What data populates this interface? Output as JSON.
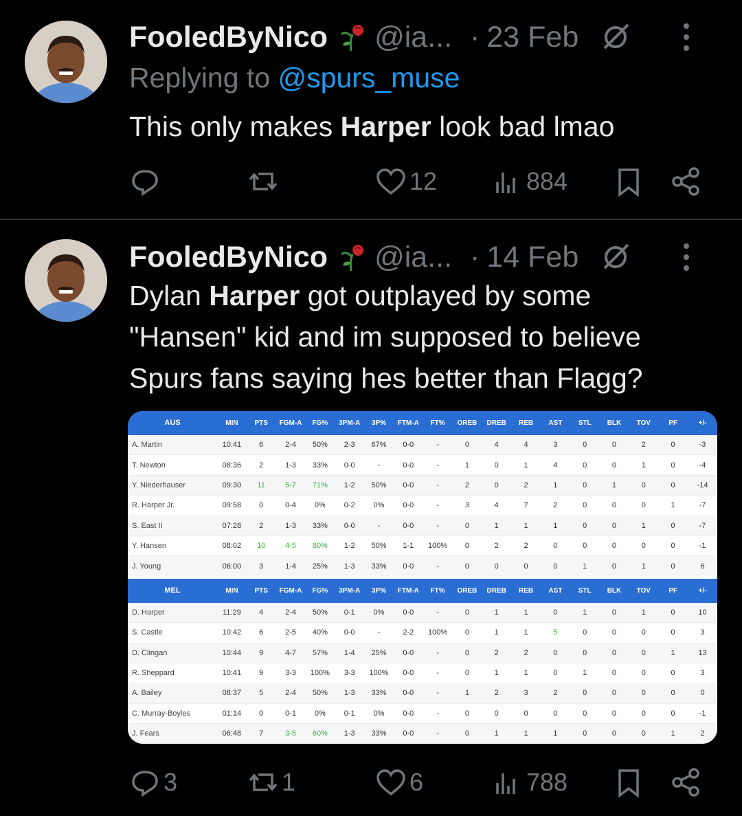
{
  "tweets": [
    {
      "display_name": "FooledByNico",
      "handle": "@ia...",
      "date": "23 Feb",
      "reply_label": "Replying to",
      "reply_to": "@spurs_muse",
      "text_before": "This only makes ",
      "text_bold": "Harper",
      "text_after": " look bad lmao",
      "likes": "12",
      "views": "884",
      "replies": "",
      "retweets": ""
    },
    {
      "display_name": "FooledByNico",
      "handle": "@ia...",
      "date": "14 Feb",
      "text_line1_a": "Dylan ",
      "text_line1_b": "Harper",
      "text_line1_c": " got outplayed by some",
      "text_line2": "\"Hansen\" kid and im supposed to believe",
      "text_line3": "Spurs fans saying hes better than Flagg?",
      "replies": "3",
      "retweets": "1",
      "likes": "6",
      "views": "788"
    }
  ],
  "stats_image": {
    "columns": [
      "MIN",
      "PTS",
      "FGM-A",
      "FG%",
      "3PM-A",
      "3P%",
      "FTM-A",
      "FT%",
      "OREB",
      "DREB",
      "REB",
      "AST",
      "STL",
      "BLK",
      "TOV",
      "PF",
      "+/-"
    ],
    "teams": [
      {
        "team": "AUS",
        "rows": [
          [
            "A. Martin",
            "10:41",
            "6",
            "2-4",
            "50%",
            "2-3",
            "67%",
            "0-0",
            "-",
            "0",
            "4",
            "4",
            "3",
            "0",
            "0",
            "2",
            "0",
            "-3"
          ],
          [
            "T. Newton",
            "08:36",
            "2",
            "1-3",
            "33%",
            "0-0",
            "-",
            "0-0",
            "-",
            "1",
            "0",
            "1",
            "4",
            "0",
            "0",
            "1",
            "0",
            "-4"
          ],
          [
            "Y. Niederhauser",
            "09:30",
            "11",
            "5-7",
            "71%",
            "1-2",
            "50%",
            "0-0",
            "-",
            "2",
            "0",
            "2",
            "1",
            "0",
            "1",
            "0",
            "0",
            "-14"
          ],
          [
            "R. Harper Jr.",
            "09:58",
            "0",
            "0-4",
            "0%",
            "0-2",
            "0%",
            "0-0",
            "-",
            "3",
            "4",
            "7",
            "2",
            "0",
            "0",
            "0",
            "1",
            "-7"
          ],
          [
            "S. East II",
            "07:28",
            "2",
            "1-3",
            "33%",
            "0-0",
            "-",
            "0-0",
            "-",
            "0",
            "1",
            "1",
            "1",
            "0",
            "0",
            "1",
            "0",
            "-7"
          ],
          [
            "Y. Hansen",
            "08:02",
            "10",
            "4-5",
            "80%",
            "1-2",
            "50%",
            "1-1",
            "100%",
            "0",
            "2",
            "2",
            "0",
            "0",
            "0",
            "0",
            "0",
            "-1"
          ],
          [
            "J. Young",
            "06:00",
            "3",
            "1-4",
            "25%",
            "1-3",
            "33%",
            "0-0",
            "-",
            "0",
            "0",
            "0",
            "0",
            "1",
            "0",
            "1",
            "0",
            "6"
          ]
        ]
      },
      {
        "team": "MEL",
        "rows": [
          [
            "D. Harper",
            "11:29",
            "4",
            "2-4",
            "50%",
            "0-1",
            "0%",
            "0-0",
            "-",
            "0",
            "1",
            "1",
            "0",
            "1",
            "0",
            "1",
            "0",
            "10"
          ],
          [
            "S. Castle",
            "10:42",
            "6",
            "2-5",
            "40%",
            "0-0",
            "-",
            "2-2",
            "100%",
            "0",
            "1",
            "1",
            "5",
            "0",
            "0",
            "0",
            "0",
            "3"
          ],
          [
            "D. Clingan",
            "10:44",
            "9",
            "4-7",
            "57%",
            "1-4",
            "25%",
            "0-0",
            "-",
            "0",
            "2",
            "2",
            "0",
            "0",
            "0",
            "0",
            "1",
            "13"
          ],
          [
            "R. Sheppard",
            "10:41",
            "9",
            "3-3",
            "100%",
            "3-3",
            "100%",
            "0-0",
            "-",
            "0",
            "1",
            "1",
            "0",
            "1",
            "0",
            "0",
            "0",
            "3"
          ],
          [
            "A. Bailey",
            "08:37",
            "5",
            "2-4",
            "50%",
            "1-3",
            "33%",
            "0-0",
            "-",
            "1",
            "2",
            "3",
            "2",
            "0",
            "0",
            "0",
            "0",
            "0"
          ],
          [
            "C. Murray-Boyles",
            "01:14",
            "0",
            "0-1",
            "0%",
            "0-1",
            "0%",
            "0-0",
            "-",
            "0",
            "0",
            "0",
            "0",
            "0",
            "0",
            "0",
            "0",
            "-1"
          ],
          [
            "J. Fears",
            "06:48",
            "7",
            "3-5",
            "60%",
            "1-3",
            "33%",
            "0-0",
            "-",
            "0",
            "1",
            "1",
            "1",
            "0",
            "0",
            "0",
            "1",
            "2"
          ]
        ]
      }
    ],
    "highlight_color": "#3cae3c",
    "header_color": "#2a6dd3"
  },
  "colors": {
    "background": "#000000",
    "text": "#e7e9ea",
    "muted": "#71767b",
    "link": "#1d9bf0",
    "divider": "#2f3336"
  }
}
